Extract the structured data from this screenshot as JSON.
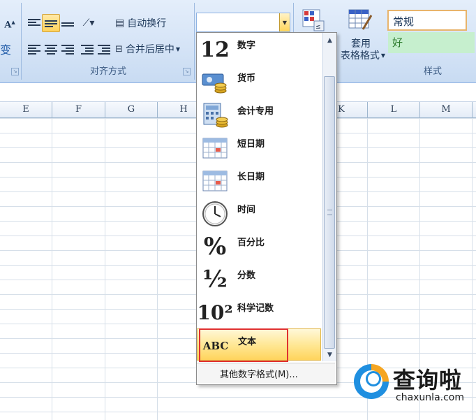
{
  "ribbon": {
    "wrap_text_label": "自动换行",
    "merge_center_label": "合并后居中",
    "alignment_group_label": "对齐方式",
    "apply_table_format_label_line1": "套用",
    "apply_table_format_label_line2": "表格格式",
    "styles_group_label": "样式",
    "style_normal": "常规",
    "style_good": "好",
    "font_partial_label": "变",
    "number_format_value": ""
  },
  "columns": [
    "E",
    "F",
    "G",
    "H",
    "K",
    "L",
    "M"
  ],
  "dropdown": {
    "items": [
      {
        "label": "数字",
        "icon": "number-icon",
        "glyph": "12"
      },
      {
        "label": "货币",
        "icon": "currency-icon",
        "glyph": ""
      },
      {
        "label": "会计专用",
        "icon": "accounting-icon",
        "glyph": ""
      },
      {
        "label": "短日期",
        "icon": "short-date-icon",
        "glyph": ""
      },
      {
        "label": "长日期",
        "icon": "long-date-icon",
        "glyph": ""
      },
      {
        "label": "时间",
        "icon": "clock-icon",
        "glyph": ""
      },
      {
        "label": "百分比",
        "icon": "percent-icon",
        "glyph": "%"
      },
      {
        "label": "分数",
        "icon": "fraction-icon",
        "glyph": "½"
      },
      {
        "label": "科学记数",
        "icon": "scientific-icon",
        "glyph": "10²"
      },
      {
        "label": "文本",
        "icon": "text-abc-icon",
        "glyph": "ABC"
      }
    ],
    "more_formats_label": "其他数字格式(M)..."
  },
  "watermark": {
    "title": "查询啦",
    "subtitle": "chaxunla.com"
  },
  "colors": {
    "selected_item": "#ffd45c",
    "highlight_border": "#e03030",
    "ribbon_bg": "#d4e3f6"
  }
}
